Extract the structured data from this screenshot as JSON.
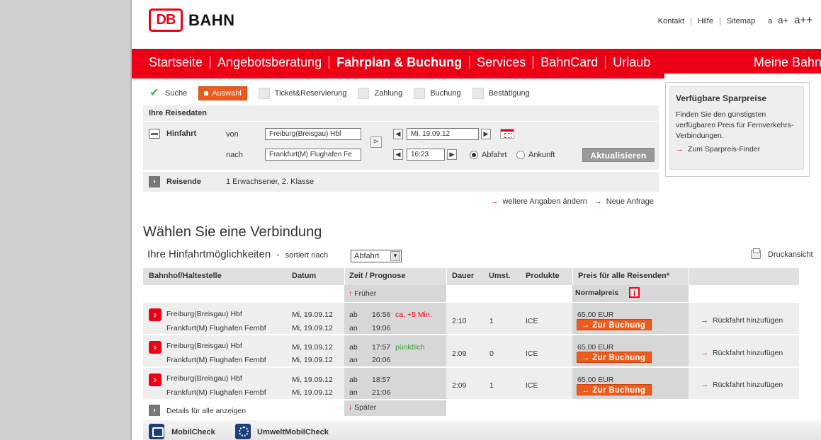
{
  "header": {
    "logo_text": "DB",
    "brand": "BAHN",
    "links": [
      "Kontakt",
      "Hilfe",
      "Sitemap"
    ],
    "font_sizes": [
      "a",
      "a+",
      "a++"
    ]
  },
  "nav": {
    "items": [
      "Startseite",
      "Angebotsberatung",
      "Fahrplan & Buchung",
      "Services",
      "BahnCard",
      "Urlaub"
    ],
    "right": "Meine Bahn"
  },
  "steps": {
    "suche": "Suche",
    "auswahl": "Auswahl",
    "ticket": "Ticket&Reservierung",
    "zahlung": "Zahlung",
    "buchung": "Buchung",
    "bestaetigung": "Bestätigung"
  },
  "reise": {
    "title": "Ihre Reisedaten",
    "hinfahrt": "Hinfahrt",
    "von_label": "von",
    "nach_label": "nach",
    "von_value": "Freiburg(Breisgau) Hbf",
    "nach_value": "Frankfurt(M) Flughafen Fe",
    "date_value": "Mi, 19.09.12",
    "time_value": "16:23",
    "abfahrt": "Abfahrt",
    "ankunft": "Ankunft",
    "update_button": "Aktualisieren",
    "reisende_label": "Reisende",
    "reisende_value": "1 Erwachsener, 2. Klasse",
    "more_link": "weitere Angaben ändern",
    "new_link": "Neue Anfrage"
  },
  "side": {
    "title": "Verfügbare Sparpreise",
    "text": "Finden Sie den günstigsten verfügbaren Preis für Fernverkehrs-Verbindungen.",
    "link": "Zum Sparpreis-Finder"
  },
  "results": {
    "title": "Wählen Sie eine Verbindung",
    "subtitle": "Ihre Hinfahrtmöglichkeiten",
    "dash": "-",
    "sort_label": "sortiert nach",
    "sort_value": "Abfahrt",
    "print": "Druckansicht",
    "columns": [
      "Bahnhof/Haltestelle",
      "Datum",
      "Zeit / Prognose",
      "Dauer",
      "Umst.",
      "Produkte",
      "Preis für alle Reisenden*"
    ],
    "earlier": "Früher",
    "later": "Später",
    "normalpreis": "Normalpreis",
    "details": "Details für alle anzeigen",
    "rows": [
      {
        "from": "Freiburg(Breisgau) Hbf",
        "to": "Frankfurt(M) Flughafen Fernbf",
        "date_from": "Mi, 19.09.12",
        "date_to": "Mi, 19.09.12",
        "ab": "ab",
        "an": "an",
        "dep": "16:56",
        "arr": "19:06",
        "prognose": "ca. +5 Min.",
        "dauer": "2:10",
        "umst": "1",
        "produkte": "ICE",
        "preis": "65,00 EUR",
        "button": "Zur Buchung",
        "return": "Rückfahrt hinzufügen"
      },
      {
        "from": "Freiburg(Breisgau) Hbf",
        "to": "Frankfurt(M) Flughafen Fernbf",
        "date_from": "Mi, 19.09.12",
        "date_to": "Mi, 19.09.12",
        "ab": "ab",
        "an": "an",
        "dep": "17:57",
        "arr": "20:06",
        "prognose": "pünktlich",
        "dauer": "2:09",
        "umst": "0",
        "produkte": "ICE",
        "preis": "65,00 EUR",
        "button": "Zur Buchung",
        "return": "Rückfahrt hinzufügen"
      },
      {
        "from": "Freiburg(Breisgau) Hbf",
        "to": "Frankfurt(M) Flughafen Fernbf",
        "date_from": "Mi, 19.09.12",
        "date_to": "Mi, 19.09.12",
        "ab": "ab",
        "an": "an",
        "dep": "18:57",
        "arr": "21:06",
        "prognose": "",
        "dauer": "2:09",
        "umst": "1",
        "produkte": "ICE",
        "preis": "65,00 EUR",
        "button": "Zur Buchung",
        "return": "Rückfahrt hinzufügen"
      }
    ]
  },
  "bottom": {
    "mobilcheck": "MobilCheck",
    "umwelt": "UmweltMobilCheck"
  }
}
